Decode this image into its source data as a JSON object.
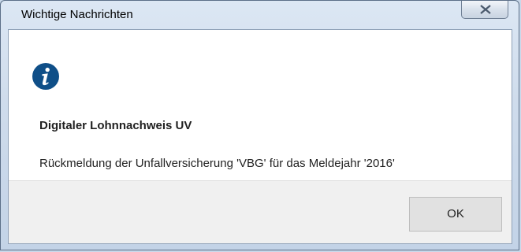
{
  "window": {
    "title": "Wichtige Nachrichten",
    "close_icon": "close-icon"
  },
  "dialog": {
    "icon": "info-icon",
    "heading": "Digitaler Lohnnachweis UV",
    "message": "Rückmeldung der Unfallversicherung 'VBG' für das Meldejahr '2016'",
    "ok_label": "OK"
  },
  "colors": {
    "info_icon": "#0f4f88",
    "content_bg": "#ffffff",
    "footer_bg": "#f0f0f0"
  }
}
